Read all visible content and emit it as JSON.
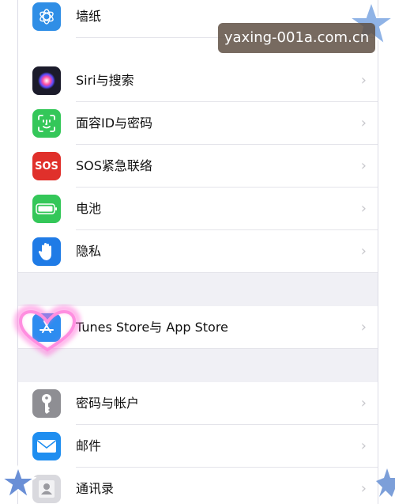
{
  "watermark": "yaxing-001a.com.cn",
  "colors": {
    "wallpaper": "#2f8ee6",
    "siri": "#1b1b2b",
    "faceid": "#34c759",
    "sos": "#e0302b",
    "battery": "#34c759",
    "privacy": "#1f7be6",
    "appstore": "#2d8cf0",
    "passwords": "#8e8e93",
    "mail": "#1f8ef0",
    "contacts": "#d9d9de"
  },
  "settings": {
    "group1": [
      {
        "label": "墙纸",
        "icon": "wallpaper-icon"
      },
      {
        "label": "Siri与搜索",
        "icon": "siri-icon"
      },
      {
        "label": "面容ID与密码",
        "icon": "face-id-icon"
      },
      {
        "label": "SOS紧急联络",
        "icon": "sos-icon",
        "icon_text": "SOS"
      },
      {
        "label": "电池",
        "icon": "battery-icon"
      },
      {
        "label": "隐私",
        "icon": "privacy-hand-icon"
      }
    ],
    "group2": [
      {
        "label": "Tunes Store与 App Store",
        "icon": "app-store-icon"
      }
    ],
    "group3": [
      {
        "label": "密码与帐户",
        "icon": "key-icon"
      },
      {
        "label": "邮件",
        "icon": "mail-icon"
      },
      {
        "label": "通讯录",
        "icon": "contacts-icon"
      }
    ]
  },
  "chevron": "›"
}
